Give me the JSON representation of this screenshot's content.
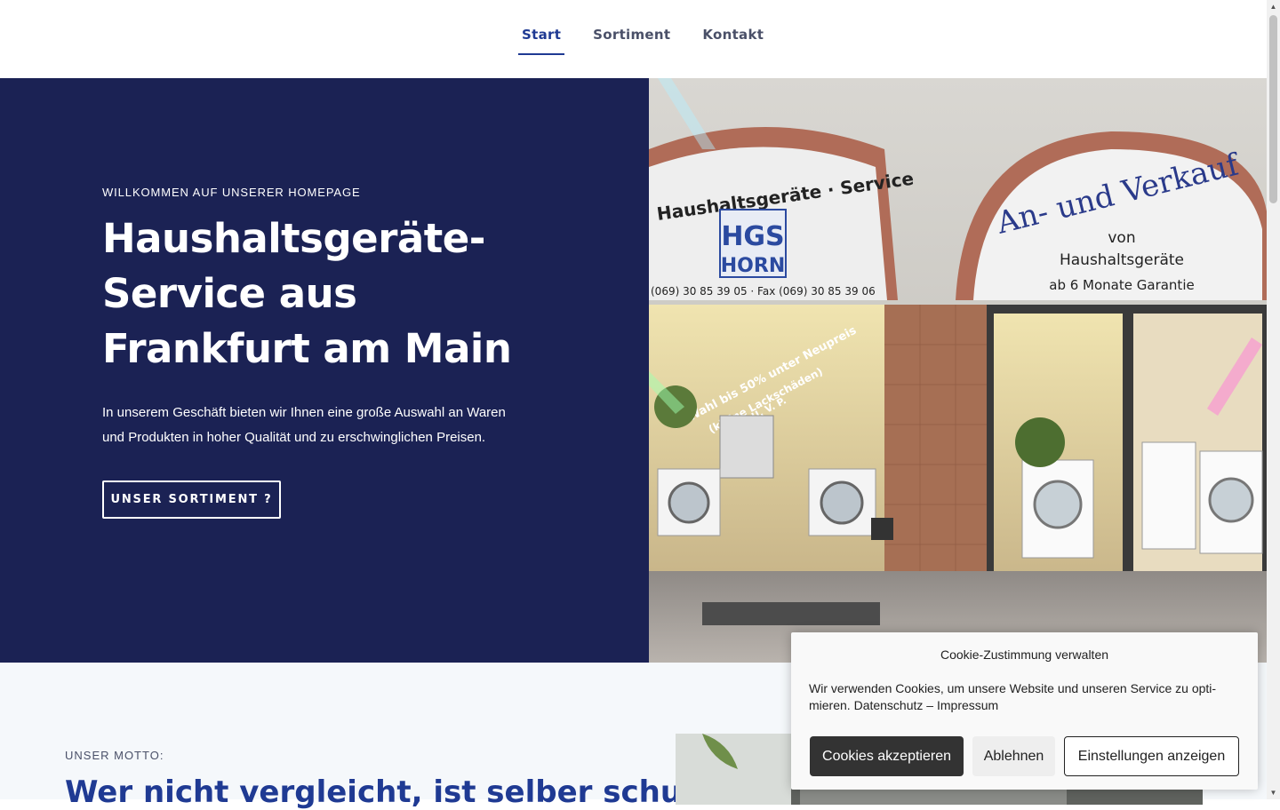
{
  "nav": {
    "items": [
      {
        "label": "Start",
        "active": true
      },
      {
        "label": "Sortiment",
        "active": false
      },
      {
        "label": "Kontakt",
        "active": false
      }
    ]
  },
  "hero": {
    "eyebrow": "WILLKOMMEN AUF UNSERER HOMEPAGE",
    "title_lines": [
      "Haushaltsgeräte-",
      "Service aus",
      "Frankfurt am Main"
    ],
    "text": "In unserem Geschäft bieten wir Ihnen eine große Auswahl an Waren und Produkten in hoher Qualität und zu erschwinglichen Preisen.",
    "button": "UNSER SORTIMENT ?"
  },
  "photo": {
    "sign_left": "Haushaltsgeräte · Service",
    "logo_top": "HGS",
    "logo_bottom": "HORN",
    "phone": "(069) 30 85 39 05 · Fax (069) 30 85 39 06",
    "sign_right_arc": "An- und Verkauf",
    "sign_right_1": "von",
    "sign_right_2": "Haushaltsgeräte",
    "sign_right_3": "ab 6 Monate Garantie",
    "window_1": "2. Wahl bis 50% unter Neupreis",
    "window_2": "(kleine Lackschäden)",
    "window_3": "U. V. P."
  },
  "motto": {
    "label": "UNSER MOTTO:",
    "title": "Wer nicht vergleicht, ist selber schuld"
  },
  "cookie": {
    "title": "Cookie-Zustimmung verwalten",
    "text": "Wir verwenden Cookies, um unsere Website und unseren Service zu opti­mieren.",
    "link_privacy": "Datenschutz",
    "separator": "–",
    "link_imprint": "Impressum",
    "accept": "Cookies akzeptieren",
    "deny": "Ablehnen",
    "settings": "Einstellungen anzeigen"
  },
  "colors": {
    "hero_bg": "#1b2254",
    "accent": "#1f3a93",
    "section_bg": "#f5f8fb"
  }
}
